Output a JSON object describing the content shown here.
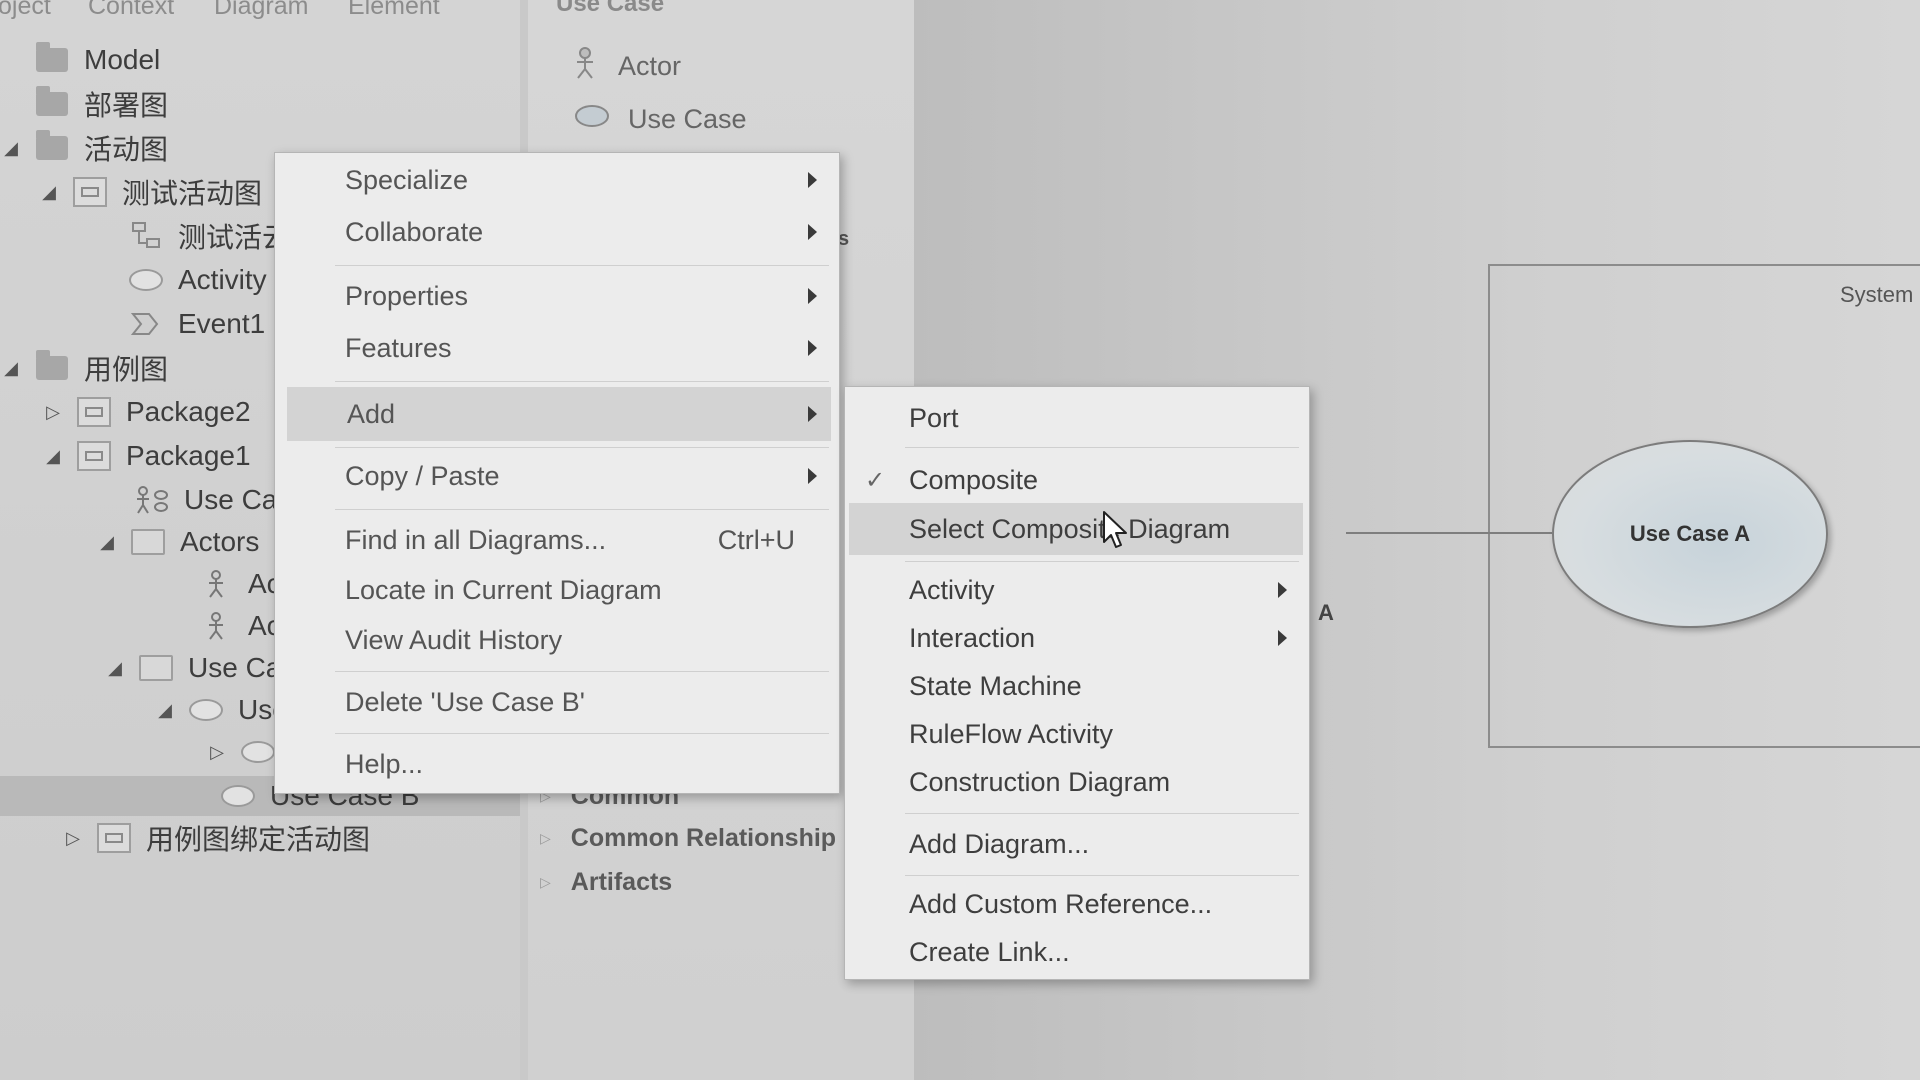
{
  "menubar": {
    "tabs": [
      "oject",
      "Context",
      "Diagram",
      "Element"
    ]
  },
  "tree": [
    {
      "label": "Model",
      "icon": "folder-icon",
      "twisty": ""
    },
    {
      "label": "部署图",
      "icon": "folder-icon",
      "twisty": ""
    },
    {
      "label": "活动图",
      "icon": "folder-icon",
      "twisty": "◢"
    },
    {
      "label": "测试活动图",
      "icon": "package-icon",
      "twisty": "◢"
    },
    {
      "label": "测试活云",
      "icon": "activity-diagram-icon",
      "twisty": ""
    },
    {
      "label": "Activity",
      "icon": "activity-icon",
      "twisty": ""
    },
    {
      "label": "Event1",
      "icon": "event-icon",
      "twisty": ""
    },
    {
      "label": "用例图",
      "icon": "folder-icon",
      "twisty": "◢"
    },
    {
      "label": "Package2",
      "icon": "package-icon",
      "twisty": "▷"
    },
    {
      "label": "Package1",
      "icon": "package-icon",
      "twisty": "◢"
    },
    {
      "label": "Use Cas",
      "icon": "usecase-diagram-icon",
      "twisty": ""
    },
    {
      "label": "Actors",
      "icon": "folder-open-icon",
      "twisty": "◢"
    },
    {
      "label": "Act",
      "icon": "actor-icon",
      "twisty": ""
    },
    {
      "label": "Act",
      "icon": "actor-icon",
      "twisty": ""
    },
    {
      "label": "Use Cas",
      "icon": "folder-open-icon",
      "twisty": "◢"
    },
    {
      "label": "Use",
      "icon": "usecase-icon",
      "twisty": "◢"
    },
    {
      "label": "",
      "icon": "usecase-icon",
      "twisty": "▷"
    },
    {
      "label": "Use Case B",
      "icon": "usecase-icon",
      "twisty": ""
    },
    {
      "label": "用例图绑定活动图",
      "icon": "package-icon",
      "twisty": "▷"
    }
  ],
  "toolbox": {
    "header": "Use Case",
    "items": [
      {
        "label": "Actor",
        "icon": "actor-icon"
      },
      {
        "label": "Use Case",
        "icon": "usecase-icon"
      }
    ],
    "partial_text": "s",
    "groups": [
      "Common",
      "Common Relationship",
      "Artifacts"
    ]
  },
  "context_menu": {
    "items": [
      {
        "label": "Specialize",
        "submenu": true
      },
      {
        "label": "Collaborate",
        "submenu": true
      },
      {
        "label": "Properties",
        "submenu": true
      },
      {
        "label": "Features",
        "submenu": true
      },
      {
        "label": "Add",
        "submenu": true,
        "highlighted": true
      },
      {
        "label": "Copy / Paste",
        "submenu": true
      },
      {
        "label": "Find in all Diagrams...",
        "shortcut": "Ctrl+U"
      },
      {
        "label": "Locate in Current Diagram"
      },
      {
        "label": "View Audit History"
      },
      {
        "label": "Delete 'Use Case B'"
      },
      {
        "label": "Help..."
      }
    ]
  },
  "add_submenu": {
    "items": [
      {
        "label": "Port"
      },
      {
        "label": "Composite",
        "checked": true
      },
      {
        "label": "Select Composite Diagram",
        "highlighted": true
      },
      {
        "label": "Activity",
        "submenu": true
      },
      {
        "label": "Interaction",
        "submenu": true
      },
      {
        "label": "State Machine"
      },
      {
        "label": "RuleFlow Activity"
      },
      {
        "label": "Construction Diagram"
      },
      {
        "label": "Add Diagram..."
      },
      {
        "label": "Add Custom Reference..."
      },
      {
        "label": "Create Link..."
      }
    ]
  },
  "canvas": {
    "system_label": "System",
    "usecase_label": "Use Case A",
    "role_label": "A"
  },
  "colors": {
    "menu_bg": "#ececec",
    "highlight": "#d3d3d3",
    "panel": "#d0d0d0"
  }
}
